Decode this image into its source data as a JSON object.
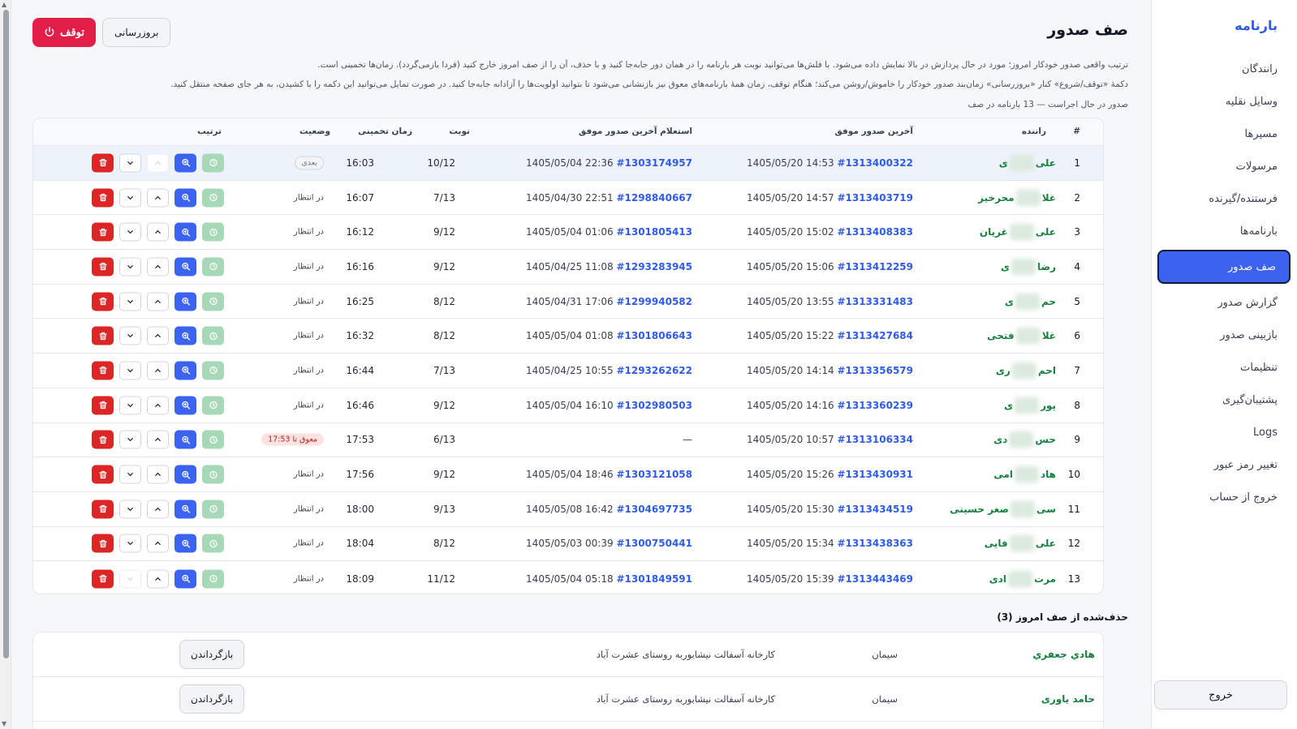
{
  "sidebar": {
    "brand": "بارنامه",
    "items": [
      {
        "label": "رانندگان",
        "active": false
      },
      {
        "label": "وسایل نقلیه",
        "active": false
      },
      {
        "label": "مسیرها",
        "active": false
      },
      {
        "label": "مرسولات",
        "active": false
      },
      {
        "label": "فرستنده/گیرنده",
        "active": false
      },
      {
        "label": "بارنامه‌ها",
        "active": false
      },
      {
        "label": "صف صدور",
        "active": true
      },
      {
        "label": "گزارش صدور",
        "active": false
      },
      {
        "label": "بازبینی صدور",
        "active": false
      },
      {
        "label": "تنظیمات",
        "active": false
      },
      {
        "label": "پشتیبان‌گیری",
        "active": false
      },
      {
        "label": "Logs",
        "active": false
      },
      {
        "label": "تغییر رمز عبور",
        "active": false
      },
      {
        "label": "خروج از حساب",
        "active": false
      }
    ],
    "logout_label": "خروج"
  },
  "header": {
    "title": "صف صدور",
    "stop_label": "توقف",
    "refresh_label": "بروزرسانی"
  },
  "description": {
    "line1": "ترتیب واقعی صدور خودکار امروز؛ مورد در حال پردازش در بالا نمایش داده می‌شود. با فلش‌ها می‌توانید نوبت هر بارنامه را در همان دور جابه‌جا کنید و با حذف، آن را از صف امروز خارج کنید (فردا بازمی‌گردد). زمان‌ها تخمینی است.",
    "line2": "دکمهٔ «توقف/شروع» کنار «بروزرسانی» زمان‌بند صدور خودکار را خاموش/روشن می‌کند؛ هنگام توقف، زمان همهٔ بارنامه‌های معوق نیز بازنشانی می‌شود تا بتوانید اولویت‌ها را آزادانه جابه‌جا کنید. در صورت تمایل می‌توانید این دکمه را با کشیدن، به هر جای صفحه منتقل کنید.",
    "status": "صدور در حال اجراست — 13 بارنامه در صف"
  },
  "table": {
    "headers": {
      "idx": "#",
      "driver": "راننده",
      "last": "آخرین صدور موفق",
      "inquiry": "استعلام آخرین صدور موفق",
      "turn": "نوبت",
      "time": "زمان تخمینی",
      "status": "وضعیت",
      "order": "ترتیب"
    },
    "rows": [
      {
        "idx": "1",
        "driver_a": "علی",
        "driver_b": "ی",
        "last_id": "#1313400322",
        "last_dt": "1405/05/20 14:53",
        "inq_id": "#1303174957",
        "inq_dt": "1405/05/04 22:36",
        "turn": "10/12",
        "time": "16:03",
        "status": "بعدی",
        "status_type": "next",
        "up_disabled": true,
        "down_disabled": false
      },
      {
        "idx": "2",
        "driver_a": "غلا",
        "driver_b": "محرخیز",
        "last_id": "#1313403719",
        "last_dt": "1405/05/20 14:57",
        "inq_id": "#1298840667",
        "inq_dt": "1405/04/30 22:51",
        "turn": "7/13",
        "time": "16:07",
        "status": "در انتظار",
        "status_type": "wait",
        "up_disabled": false,
        "down_disabled": false
      },
      {
        "idx": "3",
        "driver_a": "علی",
        "driver_b": "غریان",
        "last_id": "#1313408383",
        "last_dt": "1405/05/20 15:02",
        "inq_id": "#1301805413",
        "inq_dt": "1405/05/04 01:06",
        "turn": "9/12",
        "time": "16:12",
        "status": "در انتظار",
        "status_type": "wait",
        "up_disabled": false,
        "down_disabled": false
      },
      {
        "idx": "4",
        "driver_a": "رضا",
        "driver_b": "ی",
        "last_id": "#1313412259",
        "last_dt": "1405/05/20 15:06",
        "inq_id": "#1293283945",
        "inq_dt": "1405/04/25 11:08",
        "turn": "9/12",
        "time": "16:16",
        "status": "در انتظار",
        "status_type": "wait",
        "up_disabled": false,
        "down_disabled": false
      },
      {
        "idx": "5",
        "driver_a": "حم",
        "driver_b": "ی",
        "last_id": "#1313331483",
        "last_dt": "1405/05/20 13:55",
        "inq_id": "#1299940582",
        "inq_dt": "1405/04/31 17:06",
        "turn": "8/12",
        "time": "16:25",
        "status": "در انتظار",
        "status_type": "wait",
        "up_disabled": false,
        "down_disabled": false
      },
      {
        "idx": "6",
        "driver_a": "غلا",
        "driver_b": "فتحی",
        "last_id": "#1313427684",
        "last_dt": "1405/05/20 15:22",
        "inq_id": "#1301806643",
        "inq_dt": "1405/05/04 01:08",
        "turn": "8/12",
        "time": "16:32",
        "status": "در انتظار",
        "status_type": "wait",
        "up_disabled": false,
        "down_disabled": false
      },
      {
        "idx": "7",
        "driver_a": "احم",
        "driver_b": "ری",
        "last_id": "#1313356579",
        "last_dt": "1405/05/20 14:14",
        "inq_id": "#1293262622",
        "inq_dt": "1405/04/25 10:55",
        "turn": "7/13",
        "time": "16:44",
        "status": "در انتظار",
        "status_type": "wait",
        "up_disabled": false,
        "down_disabled": false
      },
      {
        "idx": "8",
        "driver_a": "پور",
        "driver_b": "ی",
        "last_id": "#1313360239",
        "last_dt": "1405/05/20 14:16",
        "inq_id": "#1302980503",
        "inq_dt": "1405/05/04 16:10",
        "turn": "9/12",
        "time": "16:46",
        "status": "در انتظار",
        "status_type": "wait",
        "up_disabled": false,
        "down_disabled": false
      },
      {
        "idx": "9",
        "driver_a": "حس",
        "driver_b": "دی",
        "last_id": "#1313106334",
        "last_dt": "1405/05/20 10:57",
        "inq_id": "",
        "inq_dt": "—",
        "turn": "6/13",
        "time": "17:53",
        "status": "معوق تا 17:53",
        "status_type": "late",
        "up_disabled": false,
        "down_disabled": false
      },
      {
        "idx": "10",
        "driver_a": "هاد",
        "driver_b": "امی",
        "last_id": "#1313430931",
        "last_dt": "1405/05/20 15:26",
        "inq_id": "#1303121058",
        "inq_dt": "1405/05/04 18:46",
        "turn": "9/12",
        "time": "17:56",
        "status": "در انتظار",
        "status_type": "wait",
        "up_disabled": false,
        "down_disabled": false
      },
      {
        "idx": "11",
        "driver_a": "سی",
        "driver_b": "صغر حسینی",
        "last_id": "#1313434519",
        "last_dt": "1405/05/20 15:30",
        "inq_id": "#1304697735",
        "inq_dt": "1405/05/08 16:42",
        "turn": "9/13",
        "time": "18:00",
        "status": "در انتظار",
        "status_type": "wait",
        "up_disabled": false,
        "down_disabled": false
      },
      {
        "idx": "12",
        "driver_a": "علی",
        "driver_b": "فایی",
        "last_id": "#1313438363",
        "last_dt": "1405/05/20 15:34",
        "inq_id": "#1300750441",
        "inq_dt": "1405/05/03 00:39",
        "turn": "8/12",
        "time": "18:04",
        "status": "در انتظار",
        "status_type": "wait",
        "up_disabled": false,
        "down_disabled": false
      },
      {
        "idx": "13",
        "driver_a": "مرت",
        "driver_b": "ادی",
        "last_id": "#1313443469",
        "last_dt": "1405/05/20 15:39",
        "inq_id": "#1301849591",
        "inq_dt": "1405/05/04 05:18",
        "turn": "11/12",
        "time": "18:09",
        "status": "در انتظار",
        "status_type": "wait",
        "up_disabled": false,
        "down_disabled": true
      }
    ]
  },
  "removed": {
    "title": "حذف‌شده از صف امروز (3)",
    "rows": [
      {
        "name": "هادي جعفري",
        "cargo": "سیمان",
        "dest": "کارخانه آسفالت نیشابوربه روستای عشرت آباد",
        "restore_label": "بازگرداندن"
      },
      {
        "name": "حامد یاوری",
        "cargo": "سیمان",
        "dest": "کارخانه آسفالت نیشابوربه روستای عشرت آباد",
        "restore_label": "بازگرداندن"
      }
    ]
  },
  "icons": {
    "stop": "power-icon",
    "delete": "trash-icon",
    "down": "chevron-down-icon",
    "up": "chevron-up-icon",
    "view": "zoom-icon",
    "schedule": "clock-icon"
  },
  "colors": {
    "accent": "#3b63f0",
    "danger": "#dc2626",
    "driver": "#15803d",
    "link": "#2f5bea"
  }
}
